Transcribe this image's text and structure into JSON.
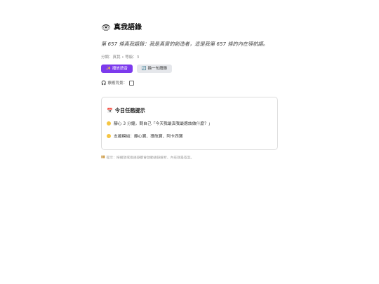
{
  "header": {
    "icon": "eye-icon",
    "icon_glyph": "👁",
    "title": "真我語錄"
  },
  "quote": "第 657 條真我語錄：我是真實的創造者，這是我第 657 條的內在導航語。",
  "meta": "分類：真我 • 等級：3",
  "buttons": {
    "primary": {
      "icon": "sparkle-icon",
      "icon_glyph": "✨",
      "label": "播放語音"
    },
    "secondary": {
      "icon": "refresh-icon",
      "icon_glyph": "🔄",
      "label": "換一句語錄"
    }
  },
  "toggle": {
    "icon": "headphones-icon",
    "icon_glyph": "🎧",
    "label": "療癒背景：",
    "checked": false
  },
  "task_card": {
    "icon": "calendar-icon",
    "icon_glyph": "📅",
    "title": "今日任務提示",
    "items": [
      {
        "text": "靜心 3 分鐘，問自己「今天我最真我最應該做什麼？」"
      },
      {
        "text": "支援模組：靜心寶、導航寶、阿卡西寶"
      }
    ]
  },
  "tip": {
    "icon": "bars-icon",
    "icon_glyph": "▮▮",
    "text": "提示：按播放或換語錄都會啟動語錄解析、內在就是答案。"
  },
  "colors": {
    "accent": "#7c3aed",
    "secondary_bg": "#e5e7eb",
    "dot": "#f5c542",
    "card_border": "#dcdcdc"
  }
}
